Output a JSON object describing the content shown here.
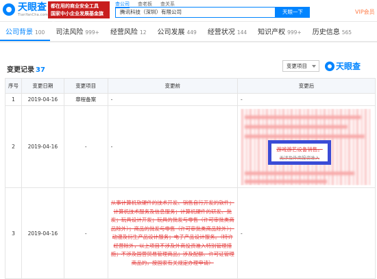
{
  "header": {
    "logo_cn": "天眼查",
    "logo_url": "TianYanCha.com",
    "promo_line1": "都在用的商业安全工具",
    "promo_line2": "国家中小企业发展基金旗下",
    "search_tabs": [
      "查公司",
      "查老板",
      "查关系"
    ],
    "search_value": "腾讯科技（深圳）有限公司",
    "search_button": "天眼一下",
    "vip": "VIP会员"
  },
  "tabs": [
    {
      "label": "公司背景",
      "count": "100"
    },
    {
      "label": "司法风险",
      "count": "999+"
    },
    {
      "label": "经营风险",
      "count": "12"
    },
    {
      "label": "公司发展",
      "count": "449"
    },
    {
      "label": "经营状况",
      "count": "144"
    },
    {
      "label": "知识产权",
      "count": "999+"
    },
    {
      "label": "历史信息",
      "count": "565"
    }
  ],
  "section": {
    "title": "变更记录",
    "count": "37",
    "select_label": "变更项目",
    "watermark": "天眼查"
  },
  "table": {
    "headers": [
      "序号",
      "变更日期",
      "变更项目",
      "变更前",
      "变更后"
    ],
    "rows": [
      {
        "no": "1",
        "date": "2019-04-16",
        "item": "章程备案",
        "before": "-",
        "after": "-"
      },
      {
        "no": "2",
        "date": "2019-04-16",
        "item": "-",
        "before": "-",
        "after_highlight": "游戏游艺设备销售。",
        "after_faint": "无涉及外商投资准入"
      },
      {
        "no": "3",
        "date": "2019-04-16",
        "item": "-",
        "before": "从事计算机软硬件的技术开发、销售自行开发的软件；计算机技术服务及信息服务；计算机硬件的研发、批发；玩具设计开发；玩具的批发与零售（许可审批类商品除外）；商品的批发与零售（许可审批类商品除外）；动漫及衍生产品设计服务；电子产品设计服务。（特许经营除外，以上项目不涉及外商投资准入特别管理措施；不涉及国营贸易管理商品；涉及配额、许可证管理商品的，按国家有关规定办理申请）",
        "after": "-"
      }
    ]
  },
  "colors": {
    "accent": "#0084ff",
    "promo": "#c81e1e",
    "strike": "#e64545",
    "highlight_border": "#3a4bd6"
  }
}
